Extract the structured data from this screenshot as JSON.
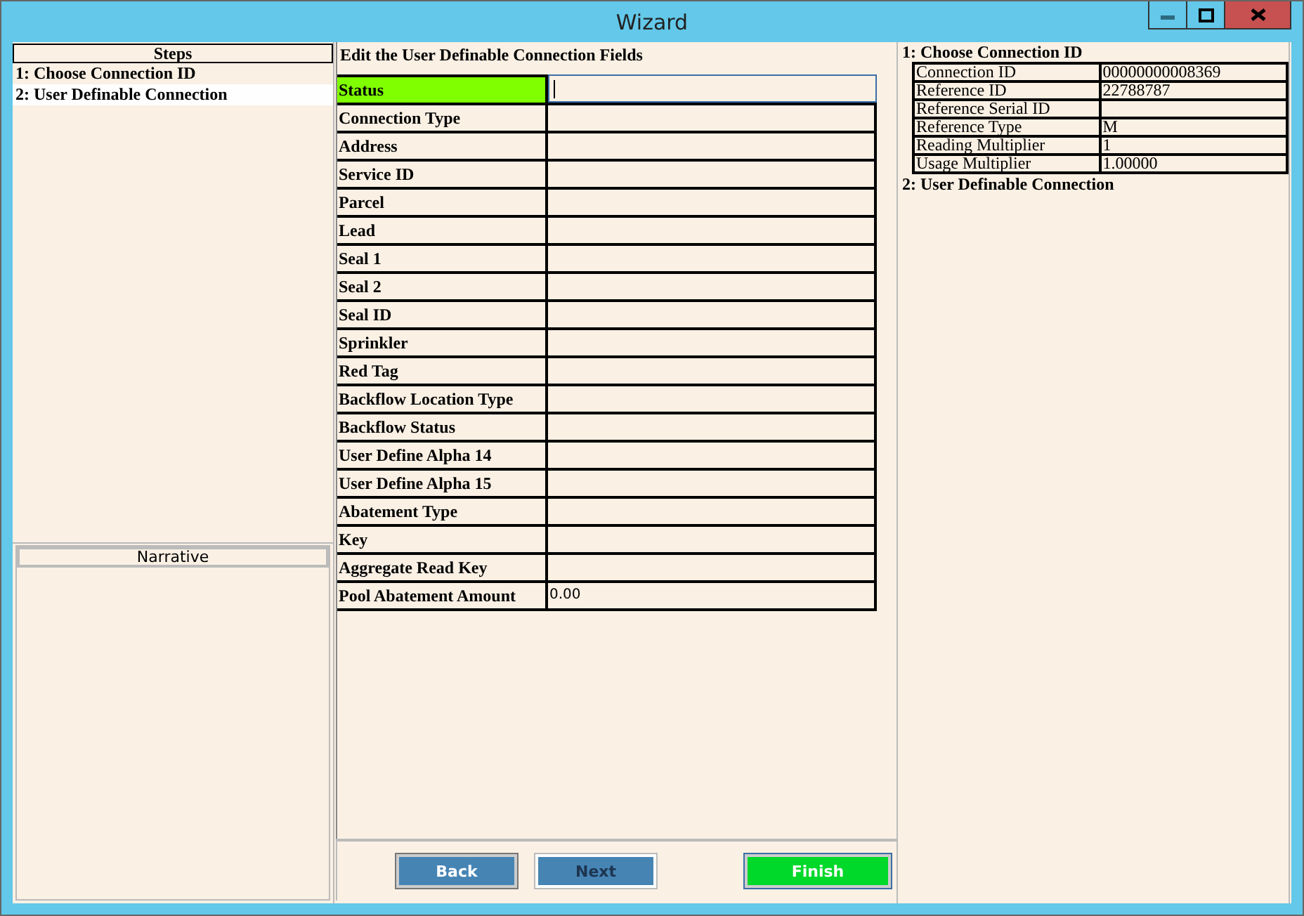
{
  "window": {
    "title": "Wizard"
  },
  "steps": {
    "title": "Steps",
    "items": [
      {
        "label": "1: Choose Connection ID",
        "selected": false
      },
      {
        "label": "2: User Definable Connection",
        "selected": true
      }
    ]
  },
  "narrative": {
    "title": "Narrative"
  },
  "form": {
    "heading": "Edit the User Definable Connection Fields",
    "fields": [
      {
        "label": "Status",
        "selected": true
      },
      {
        "label": "Connection Type",
        "selected": false
      },
      {
        "label": "Address",
        "selected": false
      },
      {
        "label": "Service ID",
        "selected": false
      },
      {
        "label": "Parcel",
        "selected": false
      },
      {
        "label": "Lead",
        "selected": false
      },
      {
        "label": "Seal 1",
        "selected": false
      },
      {
        "label": "Seal 2",
        "selected": false
      },
      {
        "label": "Seal ID",
        "selected": false
      },
      {
        "label": "Sprinkler",
        "selected": false
      },
      {
        "label": "Red Tag",
        "selected": false
      },
      {
        "label": "Backflow Location Type",
        "selected": false
      },
      {
        "label": "Backflow Status",
        "selected": false
      },
      {
        "label": "User Define Alpha 14",
        "selected": false
      },
      {
        "label": "User Define Alpha 15",
        "selected": false
      },
      {
        "label": "Abatement Type",
        "selected": false
      },
      {
        "label": "Key",
        "selected": false
      },
      {
        "label": "Aggregate Read Key",
        "selected": false
      },
      {
        "label": "Pool Abatement Amount",
        "selected": false,
        "value": "0.00"
      }
    ]
  },
  "buttons": [
    {
      "label": "Back",
      "kind": "normal",
      "disabled": false
    },
    {
      "label": "Next",
      "kind": "normal",
      "disabled": true
    },
    {
      "label": "Finish",
      "kind": "primary",
      "disabled": false
    }
  ],
  "summary": {
    "sections": [
      {
        "title": "1: Choose Connection ID",
        "rows": [
          {
            "name": "Connection ID",
            "value": "00000000008369"
          },
          {
            "name": "Reference ID",
            "value": "22788787"
          },
          {
            "name": "Reference Serial ID"
          },
          {
            "name": "Reference Type",
            "value": "M"
          },
          {
            "name": "Reading Multiplier",
            "value": "1"
          },
          {
            "name": "Usage Multiplier",
            "value": "1.00000"
          }
        ]
      },
      {
        "title": "2: User Definable Connection"
      }
    ]
  }
}
